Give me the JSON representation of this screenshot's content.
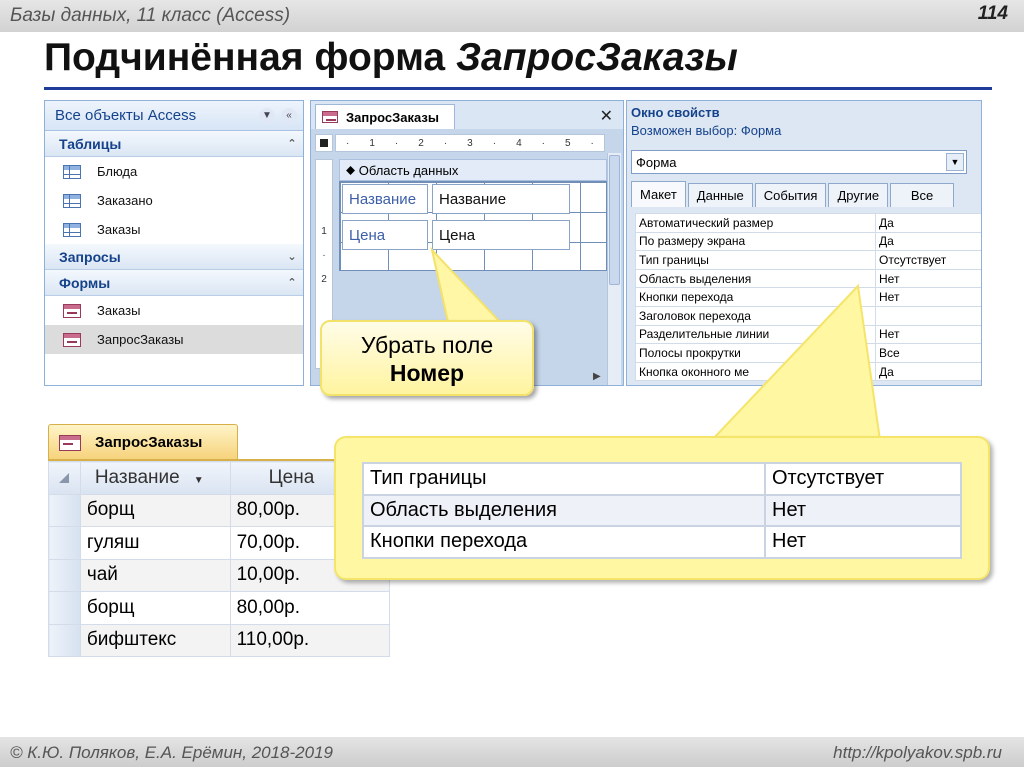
{
  "slide": {
    "course": "Базы данных, 11 класс (Access)",
    "page": "114",
    "title_main": "Подчинённая форма ",
    "title_name": "ЗапросЗаказы",
    "authors": "© К.Ю. Поляков, Е.А. Ерёмин, 2018-2019",
    "url": "http://kpolyakov.spb.ru"
  },
  "nav": {
    "header": "Все объекты Access",
    "groups": [
      {
        "label": "Таблицы",
        "items": [
          "Блюда",
          "Заказано",
          "Заказы"
        ]
      },
      {
        "label": "Запросы",
        "items": []
      },
      {
        "label": "Формы",
        "items": [
          "Заказы",
          "ЗапросЗаказы"
        ]
      }
    ],
    "selected_item": "ЗапросЗаказы"
  },
  "design": {
    "tab": "ЗапросЗаказы",
    "ruler_marks": [
      "·",
      "1",
      "·",
      "2",
      "·",
      "3",
      "·",
      "4",
      "·",
      "5",
      "·"
    ],
    "vruler_marks": [
      "1",
      "2"
    ],
    "section": "Область данных",
    "fields": [
      {
        "label": "Название",
        "control": "Название"
      },
      {
        "label": "Цена",
        "control": "Цена"
      }
    ]
  },
  "props": {
    "title": "Окно свойств",
    "selection": "Возможен выбор: Форма",
    "combo": "Форма",
    "tabs": [
      "Макет",
      "Данные",
      "События",
      "Другие",
      "Все"
    ],
    "active_tab": "Макет",
    "rows": [
      [
        "Автоматический размер",
        "Да"
      ],
      [
        "По размеру экрана",
        "Да"
      ],
      [
        "Тип границы",
        "Отсутствует"
      ],
      [
        "Область выделения",
        "Нет"
      ],
      [
        "Кнопки перехода",
        "Нет"
      ],
      [
        "Заголовок перехода",
        ""
      ],
      [
        "Разделительные линии",
        "Нет"
      ],
      [
        "Полосы прокрутки",
        "Все"
      ],
      [
        "Кнопка оконного ме",
        "Да"
      ]
    ]
  },
  "sheet": {
    "tab": "ЗапросЗаказы",
    "columns": [
      "Название",
      "Цена"
    ],
    "rows": [
      [
        "борщ",
        "80,00р."
      ],
      [
        "гуляш",
        "70,00р."
      ],
      [
        "чай",
        "10,00р."
      ],
      [
        "борщ",
        "80,00р."
      ],
      [
        "бифштекс",
        "110,00р."
      ]
    ]
  },
  "callouts": {
    "remove_line1": "Убрать поле",
    "remove_line2": "Номер",
    "zoom_rows": [
      [
        "Тип границы",
        "Отсутствует"
      ],
      [
        "Область выделения",
        "Нет"
      ],
      [
        "Кнопки перехода",
        "Нет"
      ]
    ]
  }
}
